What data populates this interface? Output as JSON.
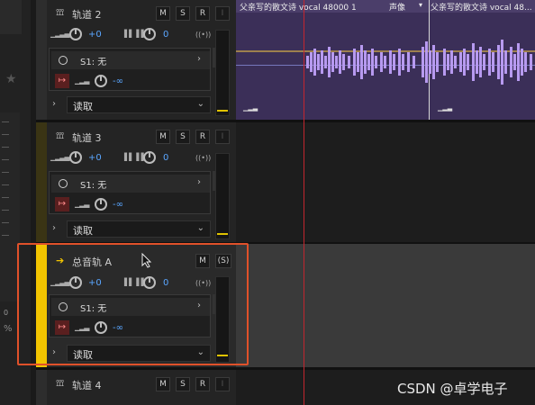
{
  "tracks": [
    {
      "name": "轨道 2",
      "m": "M",
      "s": "S",
      "r": "R",
      "i": "I",
      "vol": "+0",
      "pan": "0",
      "send": "S1: 无",
      "send_val": "-∞",
      "read": "读取"
    },
    {
      "name": "轨道 3",
      "m": "M",
      "s": "S",
      "r": "R",
      "i": "I",
      "vol": "+0",
      "pan": "0",
      "send": "S1: 无",
      "send_val": "-∞",
      "read": "读取"
    },
    {
      "name": "轨道 4",
      "m": "M",
      "s": "S",
      "r": "R",
      "i": "I"
    }
  ],
  "bus": {
    "name": "总音轨 A",
    "m": "M",
    "s": "(S)",
    "vol": "+0",
    "pan": "0",
    "send": "S1: 无",
    "send_val": "-∞",
    "read": "读取"
  },
  "clips": [
    {
      "title": "父亲写的散文诗 vocal 48000 1",
      "extra": "声像"
    },
    {
      "title": "父亲写的散文诗 vocal 48..."
    }
  ],
  "watermark": "CSDN @卓学电子",
  "left_labels": {
    "zero": "0",
    "percent": "%"
  },
  "colors": {
    "track_color": "#3a3414",
    "bus_color": "#f2c400",
    "clip": "#b79af0",
    "clip_bg": "#3b2f58",
    "highlight": "#e0512a",
    "playhead": "#c3262e",
    "value": "#5aa6ff"
  }
}
